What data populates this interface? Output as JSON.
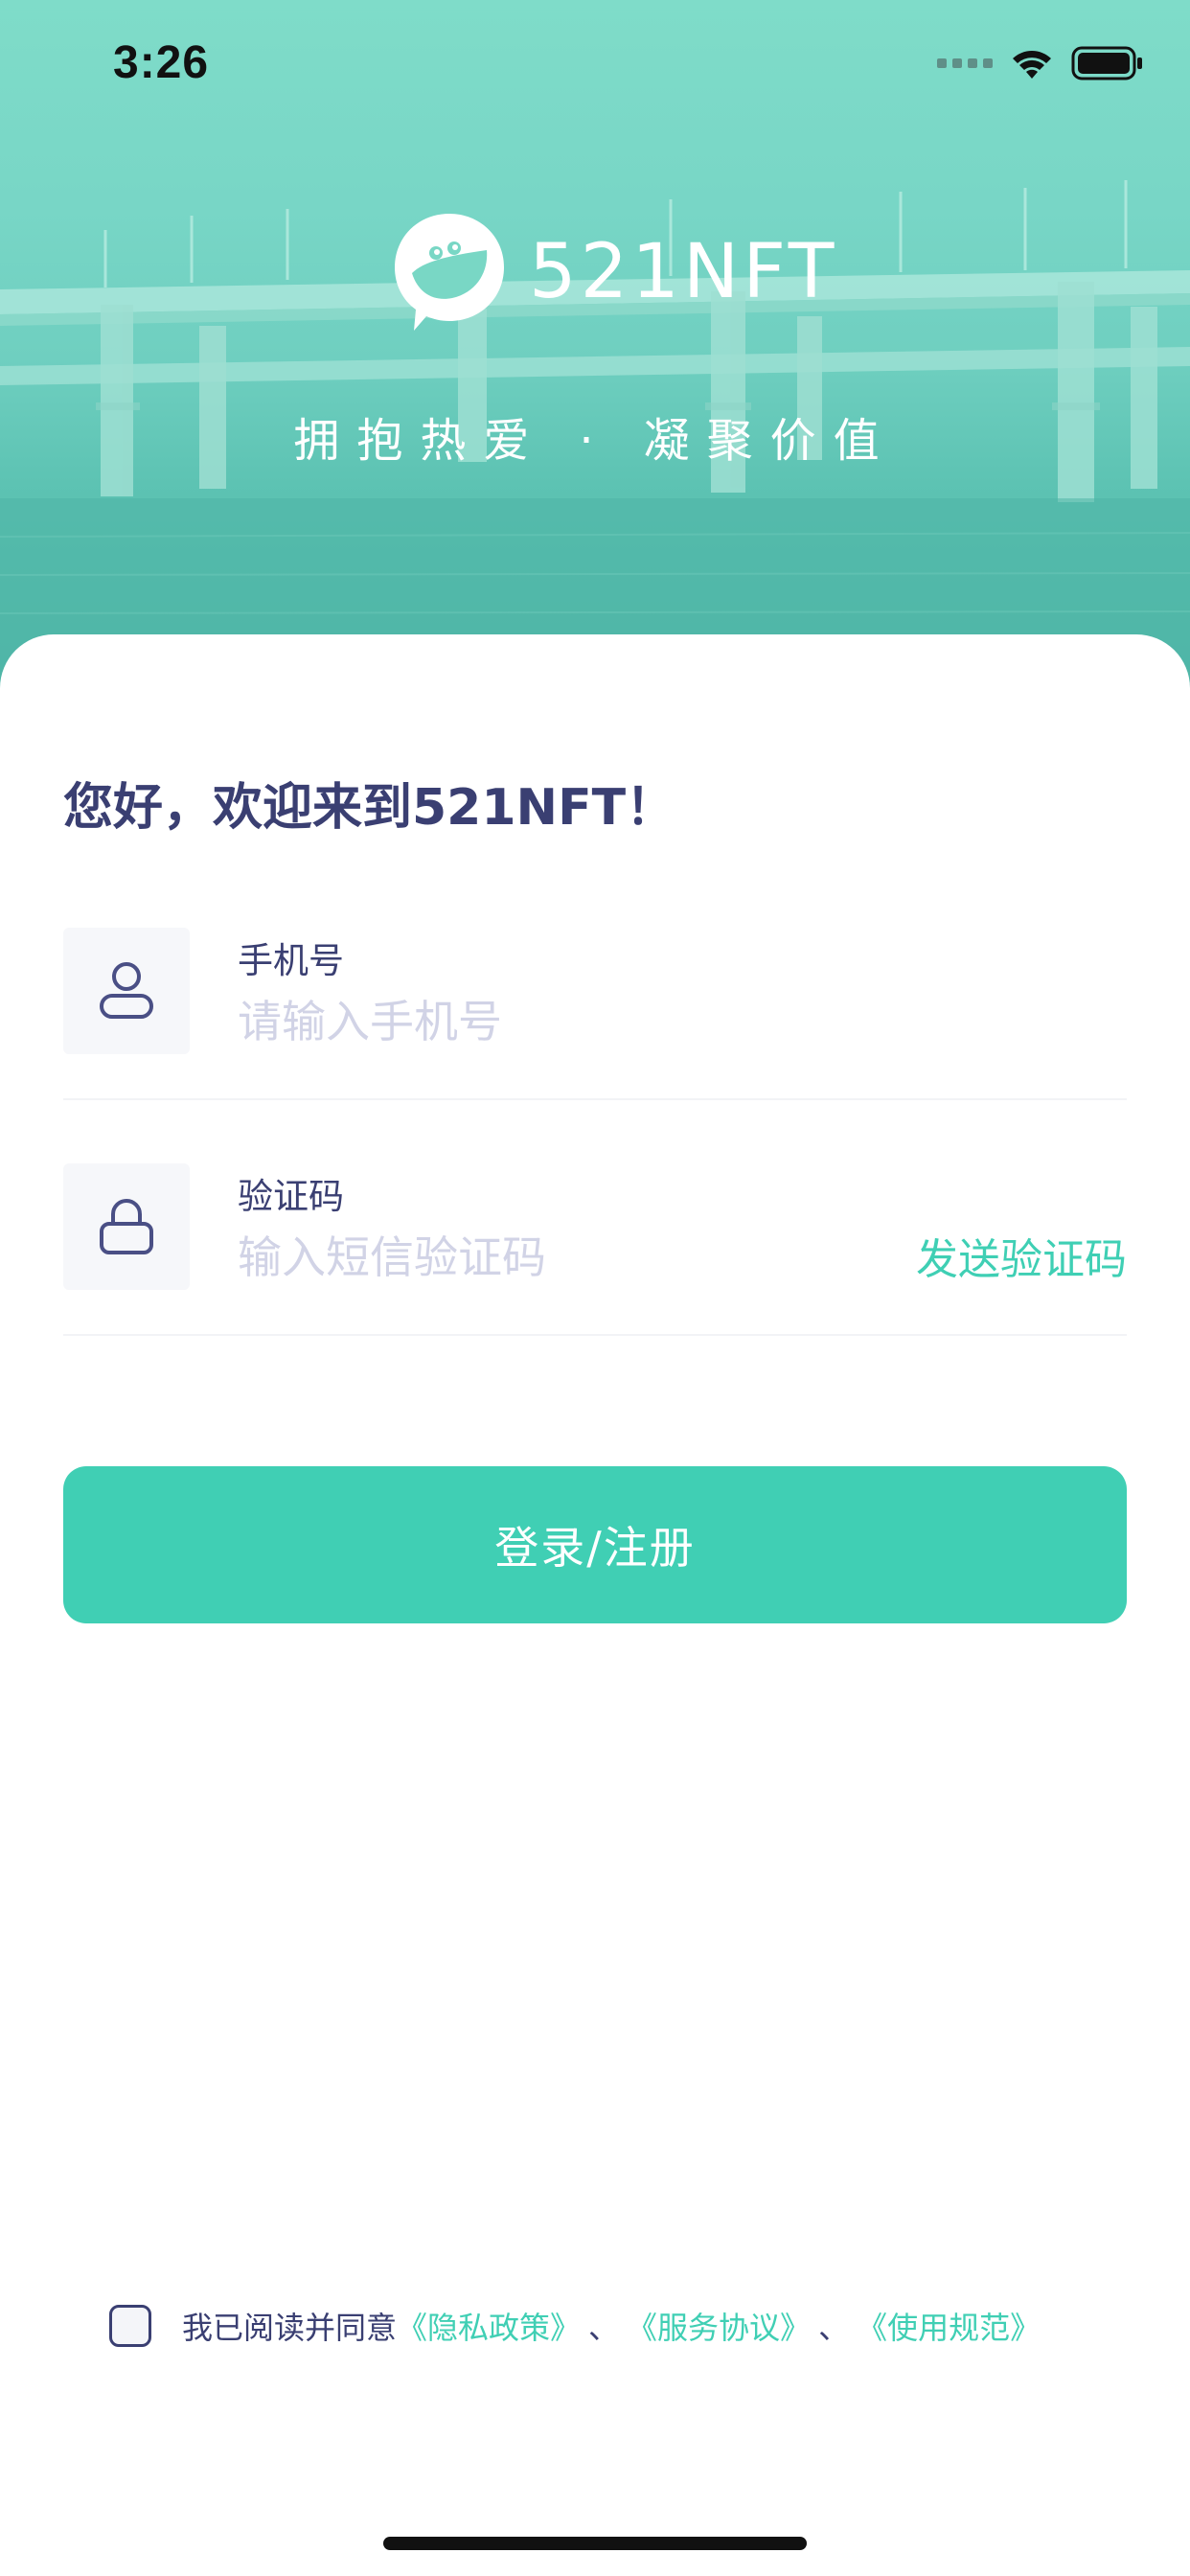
{
  "status_bar": {
    "time": "3:26"
  },
  "hero": {
    "brand_name": "521NFT",
    "slogan_left": "拥抱热爱",
    "slogan_dot": "·",
    "slogan_right": "凝聚价值"
  },
  "welcome": "您好，欢迎来到521NFT！",
  "form": {
    "phone": {
      "label": "手机号",
      "placeholder": "请输入手机号",
      "value": ""
    },
    "code": {
      "label": "验证码",
      "placeholder": "输入短信验证码",
      "value": "",
      "send_label": "发送验证码"
    },
    "submit_label": "登录/注册"
  },
  "agreement": {
    "prefix": "我已阅读并同意",
    "privacy": "《隐私政策》",
    "separator": "、",
    "service": "《服务协议》",
    "usage": "《使用规范》",
    "checked": false
  },
  "colors": {
    "accent": "#40cfb4",
    "text_primary": "#3a3f72",
    "placeholder": "#d1d3e6",
    "hero_top": "#7fdcc9"
  },
  "icons": {
    "status": [
      "signal-icon",
      "wifi-icon",
      "battery-icon"
    ],
    "fields": [
      "user-icon",
      "lock-icon"
    ],
    "brand": "chat-bubble-logo-icon"
  }
}
